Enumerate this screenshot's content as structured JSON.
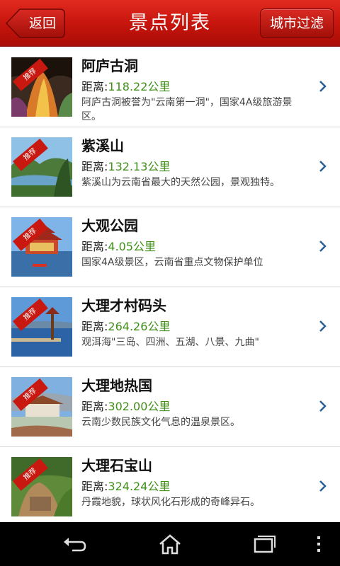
{
  "header": {
    "title": "景点列表",
    "back_label": "返回",
    "filter_label": "城市过滤",
    "color": "#d21a12"
  },
  "list": {
    "badge_label": "推荐",
    "distance_prefix": "距离:",
    "items": [
      {
        "name": "阿庐古洞",
        "distance": "118.22公里",
        "description": "阿庐古洞被誉为\"云南第一洞\"，国家4A级旅游景区。"
      },
      {
        "name": "紫溪山",
        "distance": "132.13公里",
        "description": "紫溪山为云南省最大的天然公园，景观独特。"
      },
      {
        "name": "大观公园",
        "distance": "4.05公里",
        "description": " 国家4A级景区，云南省重点文物保护单位"
      },
      {
        "name": "大理才村码头",
        "distance": "264.26公里",
        "description": "观洱海\"三岛、四洲、五湖、八景、九曲\""
      },
      {
        "name": "大理地热国",
        "distance": "302.00公里",
        "description": "云南少数民族文化气息的温泉景区。"
      },
      {
        "name": "大理石宝山",
        "distance": "324.24公里",
        "description": "丹霞地貌，球状风化石形成的奇峰异石。"
      }
    ]
  },
  "navbar": {
    "icons": [
      "back-icon",
      "home-icon",
      "recent-apps-icon",
      "menu-icon"
    ]
  }
}
